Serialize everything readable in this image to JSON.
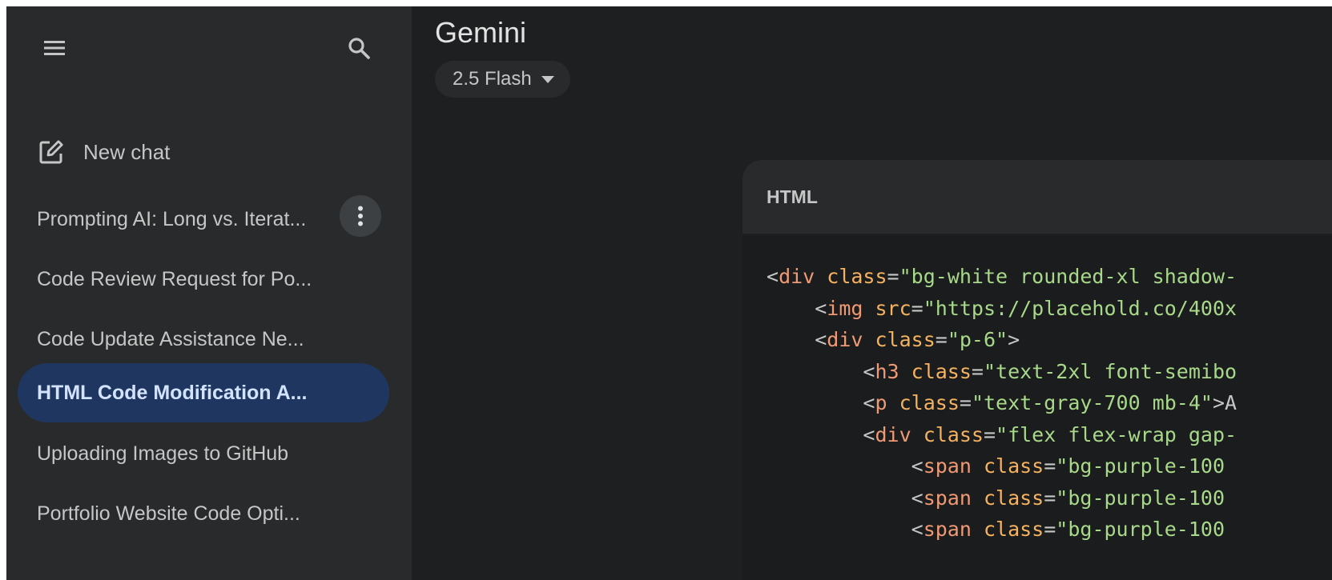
{
  "app": {
    "title": "Gemini"
  },
  "model_selector": {
    "label": "2.5 Flash"
  },
  "sidebar": {
    "new_chat_label": "New chat",
    "chats": [
      {
        "label": "Prompting AI: Long vs. Iterat...",
        "active": false
      },
      {
        "label": "Code Review Request for Po...",
        "active": false
      },
      {
        "label": "Code Update Assistance Ne...",
        "active": false
      },
      {
        "label": "HTML Code Modification A...",
        "active": true
      },
      {
        "label": "Uploading Images to GitHub",
        "active": false
      },
      {
        "label": "Portfolio Website Code Opti...",
        "active": false
      }
    ]
  },
  "code_block": {
    "language": "HTML",
    "lines": [
      {
        "indent": "",
        "tokens": [
          [
            "<",
            "punc"
          ],
          [
            "div",
            "tag"
          ],
          [
            " ",
            "punc"
          ],
          [
            "class",
            "attr"
          ],
          [
            "=",
            "punc"
          ],
          [
            "\"bg-white rounded-xl shadow-",
            "str"
          ]
        ]
      },
      {
        "indent": "    ",
        "tokens": [
          [
            "<",
            "punc"
          ],
          [
            "img",
            "tag"
          ],
          [
            " ",
            "punc"
          ],
          [
            "src",
            "attr"
          ],
          [
            "=",
            "punc"
          ],
          [
            "\"https://placehold.co/400x",
            "str"
          ]
        ]
      },
      {
        "indent": "    ",
        "tokens": [
          [
            "<",
            "punc"
          ],
          [
            "div",
            "tag"
          ],
          [
            " ",
            "punc"
          ],
          [
            "class",
            "attr"
          ],
          [
            "=",
            "punc"
          ],
          [
            "\"p-6\"",
            "str"
          ],
          [
            ">",
            "punc"
          ]
        ]
      },
      {
        "indent": "        ",
        "tokens": [
          [
            "<",
            "punc"
          ],
          [
            "h3",
            "tag"
          ],
          [
            " ",
            "punc"
          ],
          [
            "class",
            "attr"
          ],
          [
            "=",
            "punc"
          ],
          [
            "\"text-2xl font-semibo",
            "str"
          ]
        ]
      },
      {
        "indent": "        ",
        "tokens": [
          [
            "<",
            "punc"
          ],
          [
            "p",
            "tag"
          ],
          [
            " ",
            "punc"
          ],
          [
            "class",
            "attr"
          ],
          [
            "=",
            "punc"
          ],
          [
            "\"text-gray-700 mb-4\"",
            "str"
          ],
          [
            ">A",
            "punc"
          ]
        ]
      },
      {
        "indent": "        ",
        "tokens": [
          [
            "<",
            "punc"
          ],
          [
            "div",
            "tag"
          ],
          [
            " ",
            "punc"
          ],
          [
            "class",
            "attr"
          ],
          [
            "=",
            "punc"
          ],
          [
            "\"flex flex-wrap gap-",
            "str"
          ]
        ]
      },
      {
        "indent": "            ",
        "tokens": [
          [
            "<",
            "punc"
          ],
          [
            "span",
            "tag"
          ],
          [
            " ",
            "punc"
          ],
          [
            "class",
            "attr"
          ],
          [
            "=",
            "punc"
          ],
          [
            "\"bg-purple-100",
            "str"
          ]
        ]
      },
      {
        "indent": "            ",
        "tokens": [
          [
            "<",
            "punc"
          ],
          [
            "span",
            "tag"
          ],
          [
            " ",
            "punc"
          ],
          [
            "class",
            "attr"
          ],
          [
            "=",
            "punc"
          ],
          [
            "\"bg-purple-100",
            "str"
          ]
        ]
      },
      {
        "indent": "            ",
        "tokens": [
          [
            "<",
            "punc"
          ],
          [
            "span",
            "tag"
          ],
          [
            " ",
            "punc"
          ],
          [
            "class",
            "attr"
          ],
          [
            "=",
            "punc"
          ],
          [
            "\"bg-purple-100",
            "str"
          ]
        ]
      }
    ]
  },
  "colors": {
    "sidebar_bg": "#282a2c",
    "main_bg": "#1e1f20",
    "active_item_bg": "#1f3760",
    "active_item_text": "#d3e3fd",
    "code_tag": "#ef9a74",
    "code_attr": "#f5b25f",
    "code_string": "#a8d98a"
  },
  "icons": {
    "menu": "hamburger-menu-icon",
    "search": "search-icon",
    "new_chat": "edit-square-icon",
    "more": "more-vertical-icon",
    "dropdown": "caret-down-icon"
  }
}
